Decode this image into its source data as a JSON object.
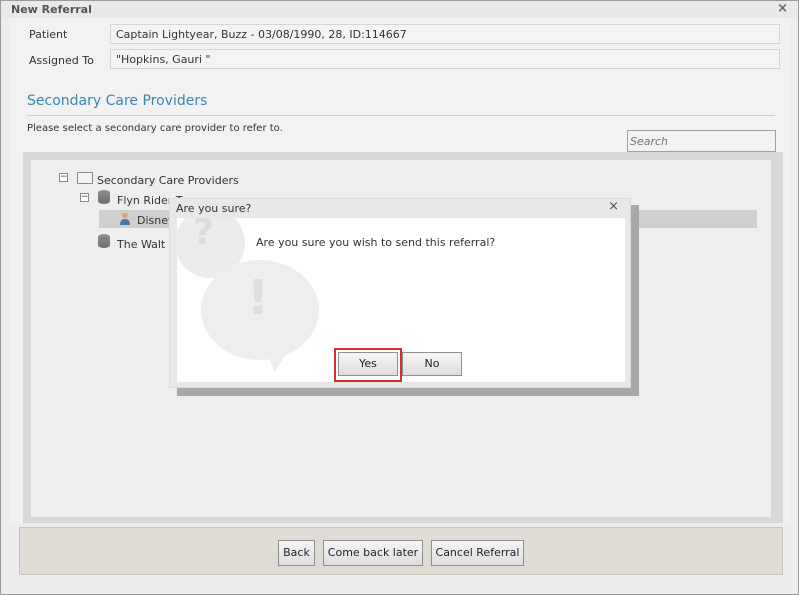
{
  "window": {
    "title": "New Referral",
    "close_glyph": "×"
  },
  "patient": {
    "label": "Patient",
    "value": "Captain Lightyear, Buzz - 03/08/1990, 28, ID:114667"
  },
  "assigned": {
    "label": "Assigned To",
    "value": "\"Hopkins, Gauri \""
  },
  "section": {
    "title": "Secondary Care Providers",
    "instruction": "Please select a secondary care provider to refer to.",
    "search_placeholder": "Search"
  },
  "tree": {
    "root": {
      "label": "Secondary Care Providers",
      "expander": "−"
    },
    "child1": {
      "label": "Flyn Rider T",
      "expander": "−"
    },
    "child1_item": {
      "label": "Disney"
    },
    "child2": {
      "label": "The Walt D"
    }
  },
  "footer": {
    "back": "Back",
    "come_back_later": "Come back later",
    "cancel_referral": "Cancel Referral"
  },
  "dialog": {
    "title": "Are you sure?",
    "close_glyph": "×",
    "message": "Are you sure you wish to send this referral?",
    "yes": "Yes",
    "no": "No",
    "icon_question": "?",
    "icon_exclamation": "!"
  },
  "colors": {
    "accent": "#3a87ad",
    "highlight": "#d62f2f"
  }
}
